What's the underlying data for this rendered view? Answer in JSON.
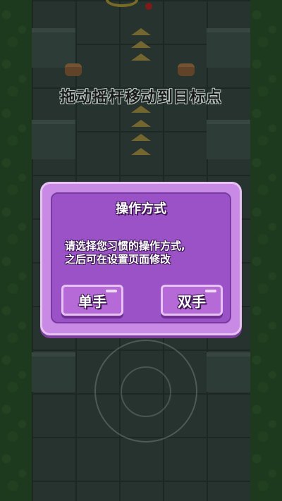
{
  "hint_text": "拖动摇杆移动到目标点",
  "dialog": {
    "title": "操作方式",
    "message_line1": "请选择您习惯的操作方式,",
    "message_line2": "之后可在设置页面修改",
    "buttons": {
      "one_hand": "单手",
      "two_hand": "双手"
    }
  },
  "colors": {
    "dialog_outer": "#c98ae6",
    "dialog_inner": "#9b52c6",
    "button": "#b66ad8",
    "text": "#ffffff"
  }
}
